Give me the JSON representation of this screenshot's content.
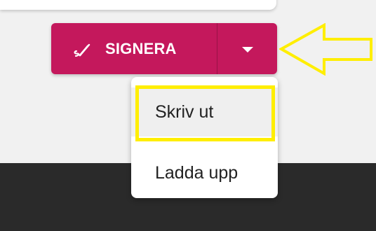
{
  "actions": {
    "sign_label": "SIGNERA",
    "menu_items": [
      {
        "label": "Skriv ut"
      },
      {
        "label": "Ladda upp"
      }
    ]
  },
  "icons": {
    "sign": "signature-pen-icon",
    "dropdown": "chevron-down-icon",
    "callout": "arrow-left-outline-icon"
  },
  "colors": {
    "accent": "#c4185c",
    "highlight": "#ffee00",
    "dark_band": "#2a2a2a",
    "background": "#f1f1f1"
  }
}
